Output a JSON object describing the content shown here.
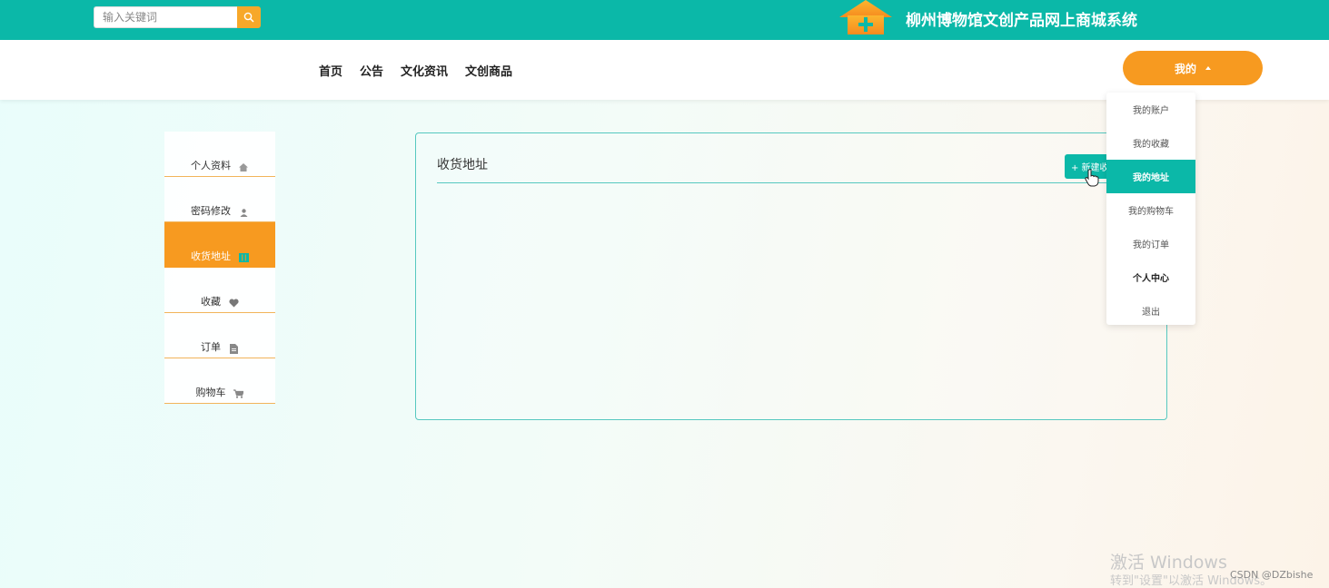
{
  "header": {
    "search": {
      "placeholder": "输入关键词",
      "value": ""
    },
    "site_title": "柳州博物馆文创产品网上商城系统"
  },
  "nav": {
    "links": [
      "首页",
      "公告",
      "文化资讯",
      "文创商品"
    ],
    "mine_label": "我的"
  },
  "dropdown": {
    "items": [
      "我的账户",
      "我的收藏",
      "我的地址",
      "我的购物车",
      "我的订单",
      "个人中心",
      "退出"
    ],
    "active_index": 2
  },
  "sidebar": {
    "items": [
      {
        "label": "个人资料",
        "icon": "home-icon"
      },
      {
        "label": "密码修改",
        "icon": "user-icon"
      },
      {
        "label": "收货地址",
        "icon": "address-book-icon"
      },
      {
        "label": "收藏",
        "icon": "heart-icon"
      },
      {
        "label": "订单",
        "icon": "document-icon"
      },
      {
        "label": "购物车",
        "icon": "cart-icon"
      }
    ],
    "active_index": 2
  },
  "main": {
    "title": "收货地址",
    "new_button_label": "+ 新建收"
  },
  "watermarks": {
    "windows_line1": "激活 Windows",
    "windows_line2": "转到\"设置\"以激活 Windows。",
    "csdn": "CSDN @DZbishe"
  },
  "colors": {
    "teal": "#0bb8a8",
    "orange": "#f79a20"
  }
}
